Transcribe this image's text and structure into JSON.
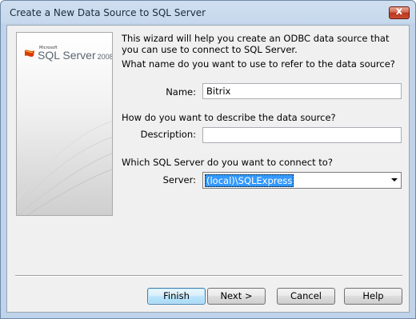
{
  "window": {
    "title": "Create a New Data Source to SQL Server",
    "close_glyph": "x"
  },
  "banner": {
    "logo_small": "Microsoft",
    "logo_main": "SQL Server",
    "logo_year": "2008",
    "logo_icon": "sql-server-flag-icon"
  },
  "intro": "This wizard will help you create an ODBC data source that you can use to connect to SQL Server.",
  "name_section": {
    "question": "What name do you want to use to refer to the data source?",
    "label": "Name:",
    "value": "Bitrix"
  },
  "description_section": {
    "question": "How do you want to describe the data source?",
    "label": "Description:",
    "value": ""
  },
  "server_section": {
    "question": "Which SQL Server do you want to connect to?",
    "label": "Server:",
    "value": "(local)\\SQLExpress"
  },
  "buttons": {
    "finish": "Finish",
    "next": "Next >",
    "cancel": "Cancel",
    "help": "Help"
  },
  "colors": {
    "accent_selection": "#3399ff",
    "titlebar": "#c6d8ec",
    "close_button": "#c84f33"
  }
}
